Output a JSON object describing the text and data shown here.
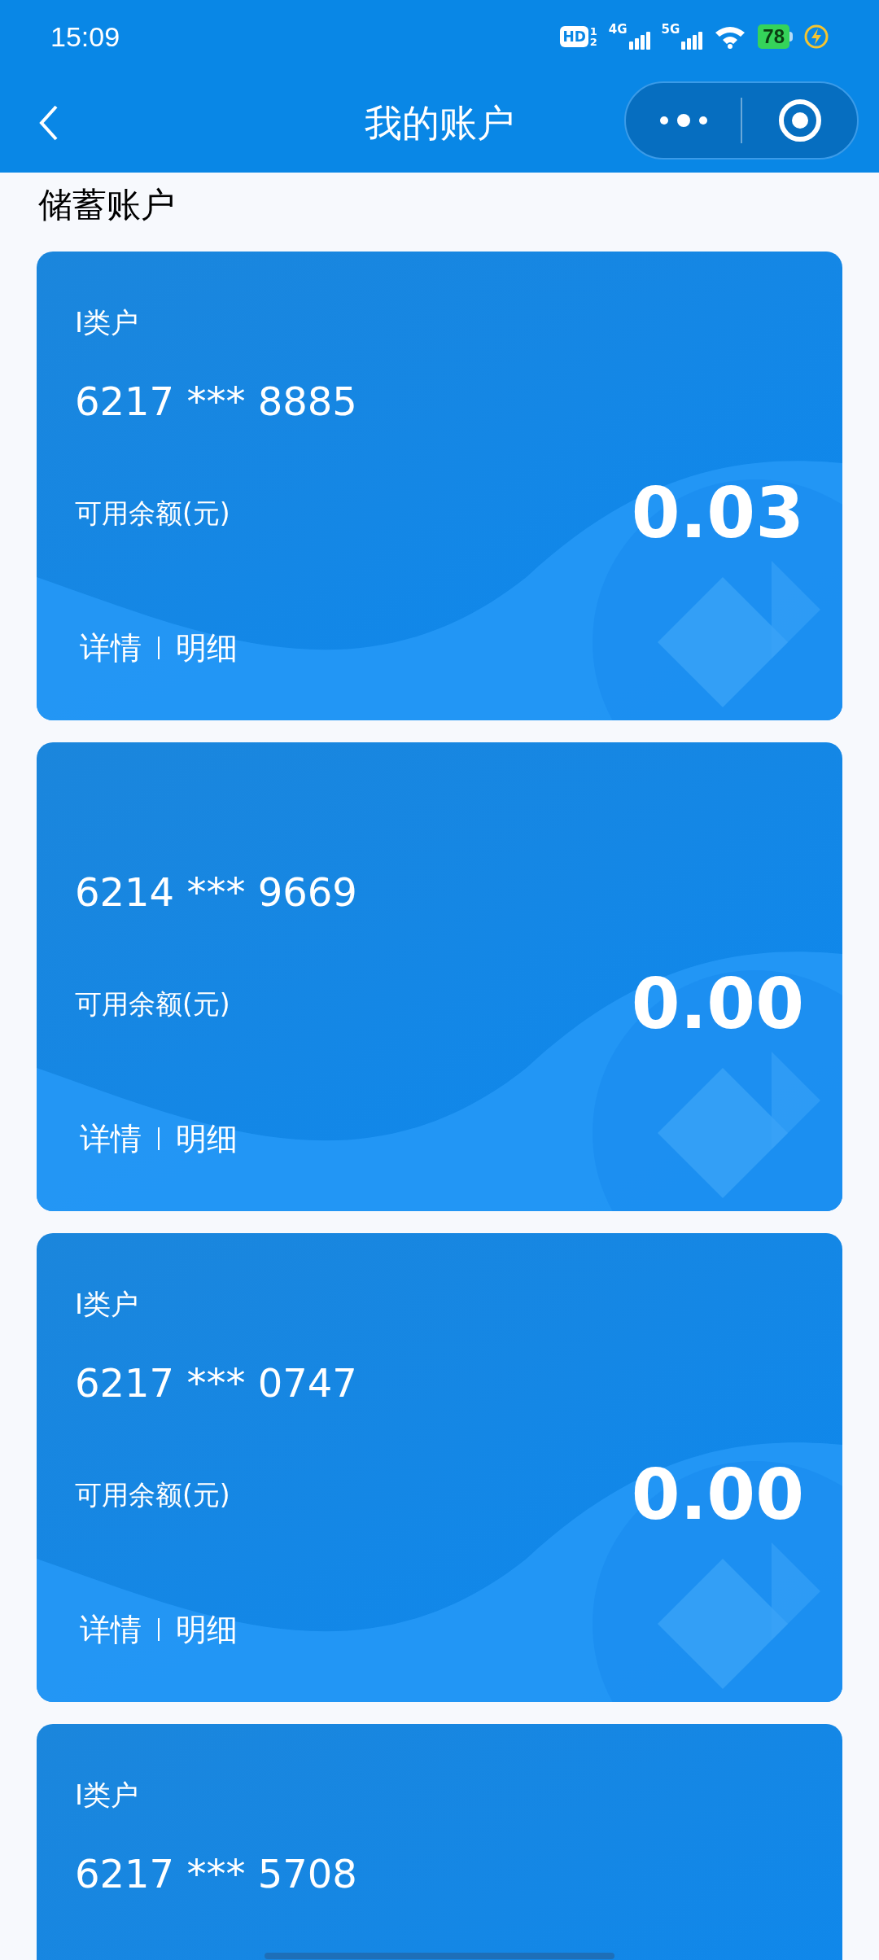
{
  "status_bar": {
    "time": "15:09",
    "hd": "HD",
    "hd_sims": [
      "1",
      "2"
    ],
    "signals": [
      "4G",
      "5G"
    ],
    "battery": "78",
    "charging": true
  },
  "nav": {
    "title": "我的账户"
  },
  "section_title": "储蓄账户",
  "accounts": [
    {
      "type_label": "I类户",
      "number": "6217 *** 8885",
      "balance_label": "可用余额(元)",
      "balance": "0.03",
      "links": [
        "详情",
        "明细"
      ]
    },
    {
      "number": "6214 *** 9669",
      "balance_label": "可用余额(元)",
      "balance": "0.00",
      "links": [
        "详情",
        "明细"
      ]
    },
    {
      "type_label": "I类户",
      "number": "6217 *** 0747",
      "balance_label": "可用余额(元)",
      "balance": "0.00",
      "links": [
        "详情",
        "明细"
      ]
    },
    {
      "type_label": "I类户",
      "number": "6217 *** 5708"
    }
  ]
}
